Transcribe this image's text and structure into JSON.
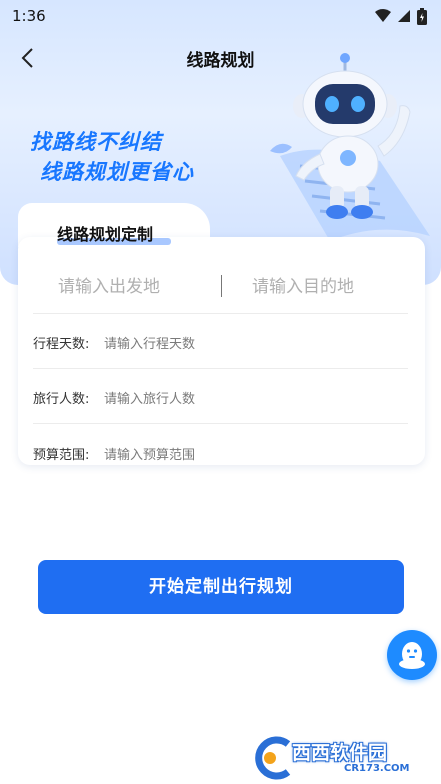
{
  "status_bar": {
    "time": "1:36"
  },
  "nav": {
    "title": "线路规划"
  },
  "hero": {
    "slogan_line1": "找路线不纠结",
    "slogan_line2": "线路规划更省心"
  },
  "card": {
    "tab_title": "线路规划定制",
    "departure_placeholder": "请输入出发地",
    "destination_placeholder": "请输入目的地",
    "fields": [
      {
        "label": "行程天数:",
        "placeholder": "请输入行程天数"
      },
      {
        "label": "旅行人数:",
        "placeholder": "请输入旅行人数"
      },
      {
        "label": "预算范围:",
        "placeholder": "请输入预算范围"
      }
    ]
  },
  "actions": {
    "start_label": "开始定制出行规划"
  },
  "watermark": {
    "brand": "西西软件园",
    "domain": "CR173.COM"
  },
  "colors": {
    "primary": "#1f6ef2",
    "slogan": "#1877ff",
    "support": "#1e8bff"
  },
  "icons": [
    "wifi-icon",
    "signal-icon",
    "battery-icon",
    "back-arrow-icon",
    "robot-mascot-icon",
    "customer-service-icon"
  ]
}
